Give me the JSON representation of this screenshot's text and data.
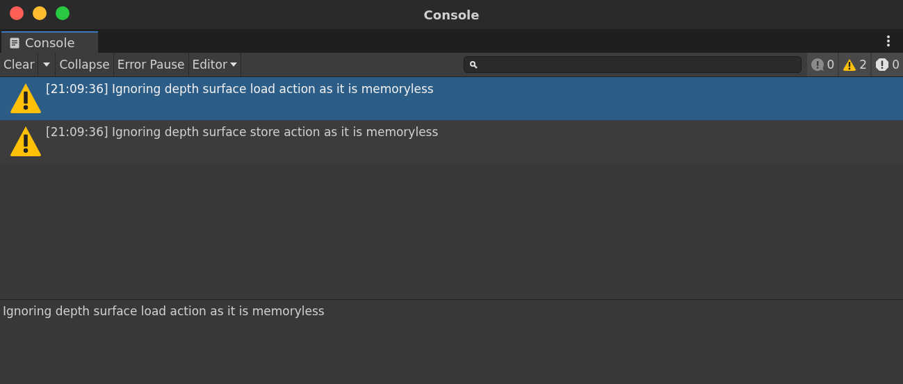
{
  "window": {
    "title": "Console"
  },
  "tabs": [
    {
      "label": "Console",
      "selected": true
    }
  ],
  "toolbar": {
    "clear": "Clear",
    "collapse": "Collapse",
    "error_pause": "Error Pause",
    "editor": "Editor"
  },
  "counters": [
    {
      "kind": "info",
      "count": "0"
    },
    {
      "kind": "warning",
      "count": "2"
    },
    {
      "kind": "error",
      "count": "0"
    }
  ],
  "entries": [
    {
      "kind": "warning",
      "text": "[21:09:36] Ignoring depth surface load action as it is memoryless",
      "selected": true
    },
    {
      "kind": "warning",
      "text": "[21:09:36] Ignoring depth surface store action as it is memoryless",
      "selected": false
    }
  ],
  "details": {
    "text": "Ignoring depth surface load action as it is memoryless"
  }
}
